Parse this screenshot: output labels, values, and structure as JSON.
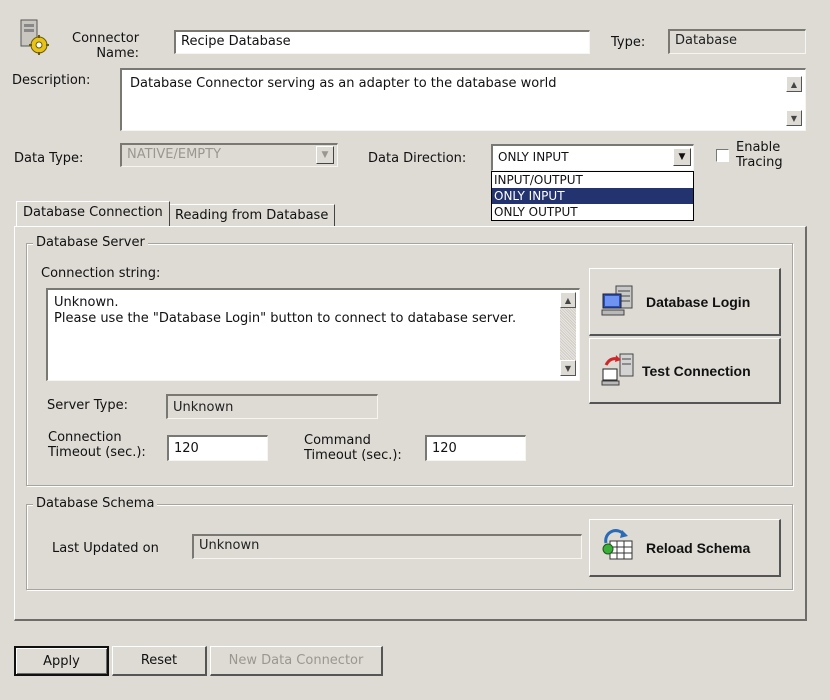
{
  "header": {
    "connector_label_line1": "Connector",
    "connector_label_line2": "Name:",
    "connector_name": "Recipe Database",
    "type_label": "Type:",
    "type_value": "Database",
    "description_label": "Description:",
    "description_value": "Database Connector serving as an adapter to the database world"
  },
  "data_type": {
    "label": "Data Type:",
    "value": "NATIVE/EMPTY"
  },
  "data_direction": {
    "label": "Data Direction:",
    "value": "ONLY INPUT",
    "options": [
      "INPUT/OUTPUT",
      "ONLY INPUT",
      "ONLY OUTPUT"
    ],
    "selected_index": 1
  },
  "tracing": {
    "label_line1": "Enable",
    "label_line2": "Tracing",
    "checked": false
  },
  "tabs": [
    {
      "label": "Database Connection",
      "active": true
    },
    {
      "label": "Reading from Database",
      "active": false
    }
  ],
  "server": {
    "group_title": "Database  Server",
    "conn_string_label": "Connection string:",
    "conn_string_line1": "Unknown.",
    "conn_string_line2": "Please use the \"Database Login\" button to connect to database server.",
    "login_button": "Database Login",
    "test_button": "Test Connection",
    "server_type_label": "Server Type:",
    "server_type_value": "Unknown",
    "conn_timeout_label_line1": "Connection",
    "conn_timeout_label_line2": "Timeout (sec.):",
    "conn_timeout_value": "120",
    "cmd_timeout_label_line1": "Command",
    "cmd_timeout_label_line2": "Timeout (sec.):",
    "cmd_timeout_value": "120"
  },
  "schema": {
    "group_title": "Database Schema",
    "last_updated_label": "Last Updated on",
    "last_updated_value": "Unknown",
    "reload_button": "Reload Schema"
  },
  "footer": {
    "apply": "Apply",
    "reset": "Reset",
    "new_connector": "New Data Connector"
  },
  "colors": {
    "background": "#dedbd5",
    "selection": "#22336f",
    "disabled_text": "#9a978f"
  }
}
